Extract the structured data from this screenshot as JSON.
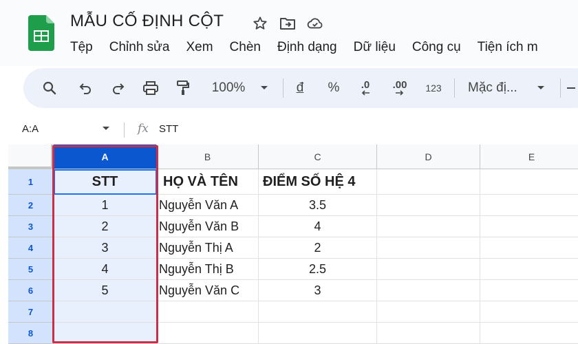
{
  "doc": {
    "title": "MẪU CỐ ĐỊNH CỘT"
  },
  "menu": [
    "Tệp",
    "Chỉnh sửa",
    "Xem",
    "Chèn",
    "Định dạng",
    "Dữ liệu",
    "Công cụ",
    "Tiện ích m"
  ],
  "toolbar": {
    "zoom": "100%",
    "currency": "đ",
    "percent": "%",
    "decrease_decimal": ".0",
    "increase_decimal": ".00",
    "number_format": "123",
    "font": "Mặc đị..."
  },
  "formula_bar": {
    "name_box": "A:A",
    "fx": "fx",
    "value": "STT"
  },
  "columns": [
    "A",
    "B",
    "C",
    "D",
    "E"
  ],
  "rows": [
    "1",
    "2",
    "3",
    "4",
    "5",
    "6",
    "7",
    "8"
  ],
  "cells": [
    [
      "STT",
      "HỌ VÀ TÊN",
      "ĐIỂM SỐ HỆ 4",
      "",
      ""
    ],
    [
      "1",
      "Nguyễn Văn A",
      "3.5",
      "",
      ""
    ],
    [
      "2",
      "Nguyễn Văn B",
      "4",
      "",
      ""
    ],
    [
      "3",
      "Nguyễn Thị A",
      "2",
      "",
      ""
    ],
    [
      "4",
      "Nguyễn Thị B",
      "2.5",
      "",
      ""
    ],
    [
      "5",
      "Nguyễn Văn C",
      "3",
      "",
      ""
    ],
    [
      "",
      "",
      "",
      "",
      ""
    ],
    [
      "",
      "",
      "",
      "",
      ""
    ]
  ],
  "selection": {
    "column": "A",
    "highlight_color": "#c8304a",
    "header_color": "#0b57d0"
  }
}
